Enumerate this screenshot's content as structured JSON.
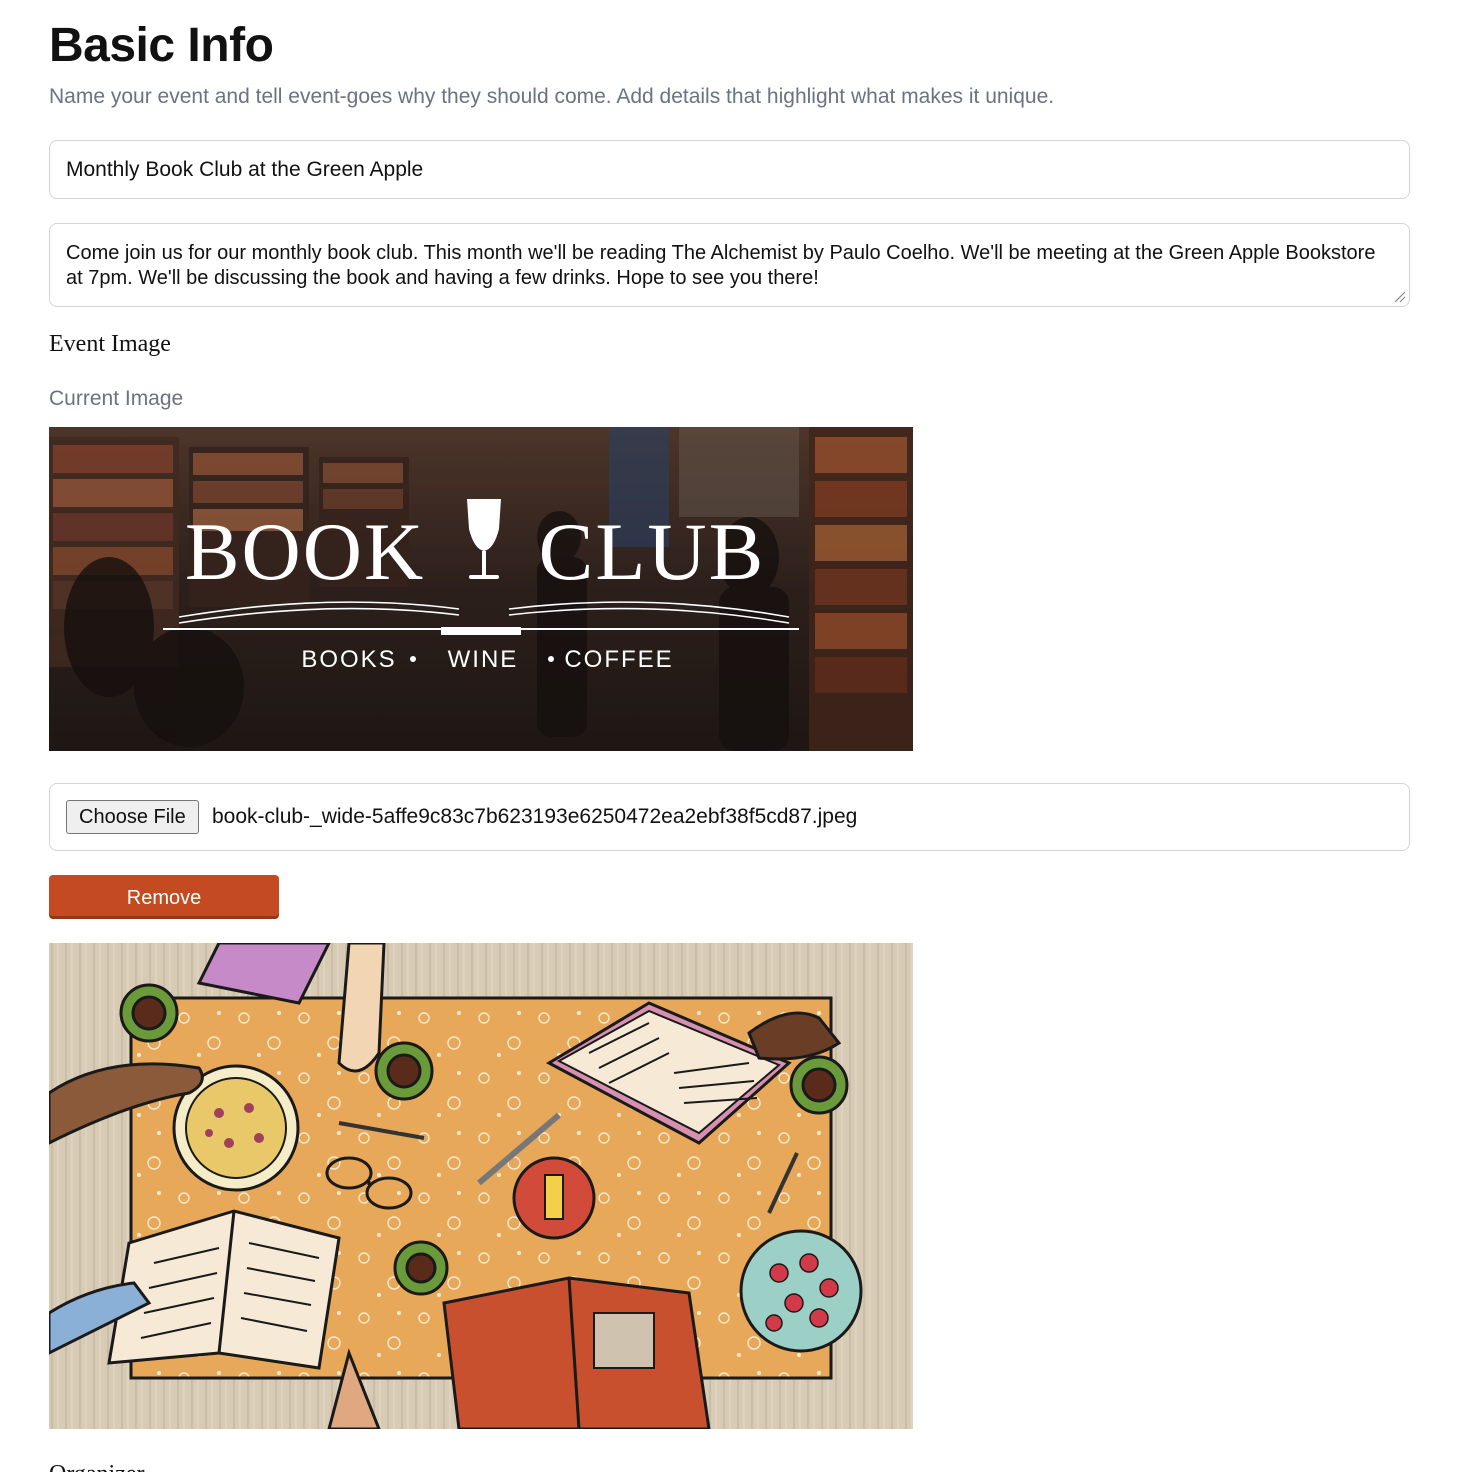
{
  "header": {
    "title": "Basic Info",
    "subtitle": "Name your event and tell event-goes why they should come. Add details that highlight what makes it unique."
  },
  "form": {
    "event_title_value": "Monthly Book Club at the Green Apple",
    "description_value": "Come join us for our monthly book club. This month we'll be reading The Alchemist by Paulo Coelho. We'll be meeting at the Green Apple Bookstore at 7pm. We'll be discussing the book and having a few drinks. Hope to see you there!"
  },
  "event_image": {
    "section_label": "Event Image",
    "current_label": "Current Image",
    "banner": {
      "wordmark_left": "BOOK",
      "wordmark_right": "CLUB",
      "tagline_1": "BOOKS",
      "tagline_2": "WINE",
      "tagline_3": "COFFEE"
    },
    "choose_file_label": "Choose File",
    "file_name": "book-club-_wide-5affe9c83c7b623193e6250472ea2ebf38f5cd87.jpeg",
    "remove_label": "Remove"
  },
  "organizer": {
    "section_label": "Organizer"
  },
  "colors": {
    "remove_button": "#c44a22",
    "muted_text": "#6b7280",
    "border": "#d1d5db",
    "illustration_table": "#e8a85a"
  }
}
